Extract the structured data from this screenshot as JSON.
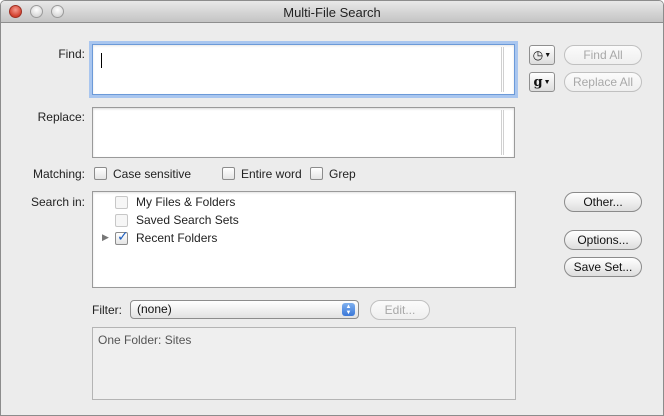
{
  "window": {
    "title": "Multi-File Search"
  },
  "labels": {
    "find": "Find:",
    "replace": "Replace:",
    "matching": "Matching:",
    "search_in": "Search in:",
    "filter": "Filter:"
  },
  "find": {
    "value": ""
  },
  "replace": {
    "value": ""
  },
  "buttons": {
    "find_all": "Find All",
    "replace_all": "Replace All",
    "other": "Other...",
    "options": "Options...",
    "save_set": "Save Set...",
    "edit": "Edit..."
  },
  "icons": {
    "history": "clock-icon",
    "grep_patterns": "g-icon"
  },
  "matching": [
    {
      "label": "Case sensitive",
      "checked": false
    },
    {
      "label": "Entire word",
      "checked": false
    },
    {
      "label": "Grep",
      "checked": false
    }
  ],
  "search_in": [
    {
      "label": "My Files & Folders",
      "checked": false,
      "expandable": false
    },
    {
      "label": "Saved Search Sets",
      "checked": false,
      "expandable": false
    },
    {
      "label": "Recent Folders",
      "checked": true,
      "expandable": true
    }
  ],
  "filter": {
    "selected": "(none)"
  },
  "summary": "One Folder: Sites",
  "colors": {
    "focus_ring": "#a9c6ef",
    "check_blue": "#1f5fbf",
    "popup_blue": "#3b78d8"
  }
}
